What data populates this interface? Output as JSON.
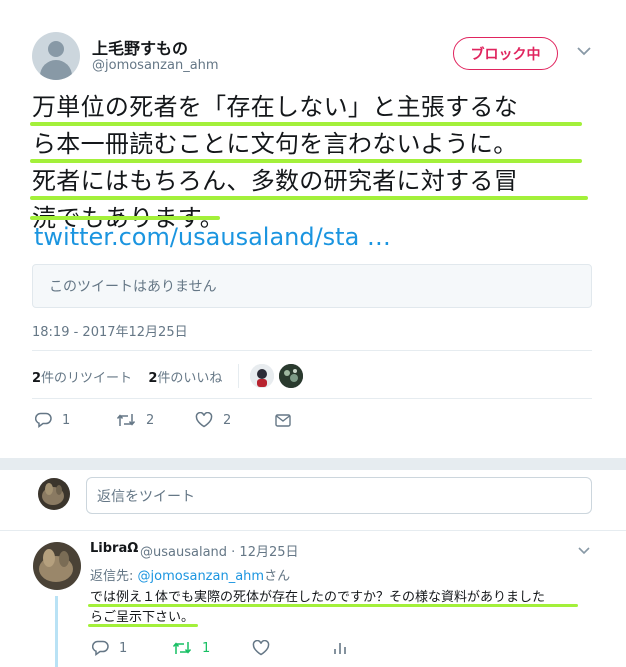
{
  "main_tweet": {
    "display_name": "上毛野すもの",
    "screen_name": "@jomosanzan_ahm",
    "block_button_label": "ブロック中",
    "caret_icon": "chevron-down-icon",
    "text_lines": [
      "万単位の死者を「存在しない」と主張するな",
      "ら本一冊読むことに文句を言わないように。",
      "死者にはもちろん、多数の研究者に対する冒",
      "涜でもあります。"
    ],
    "link_text": "twitter.com/usausaland/sta …",
    "quoted_tweet_unavailable": "このツイートはありません",
    "timestamp": "18:19 - 2017年12月25日",
    "retweets_count": "2",
    "retweets_label": "件のリツイート",
    "likes_count": "2",
    "likes_label": "件のいいね",
    "actions": {
      "reply_count": "1",
      "retweet_count": "2",
      "like_count": "2"
    }
  },
  "reply_box": {
    "placeholder": "返信をツイート"
  },
  "reply_tweet": {
    "display_name": "LibraΩ",
    "handle_and_date": "@usausaland · 12月25日",
    "replying_to_prefix": "返信先: ",
    "replying_to_mention": "@jomosanzan_ahm",
    "replying_to_suffix": "さん",
    "text_lines": [
      "では例え１体でも実際の死体が存在したのですか？その様な資料がありました",
      "らご呈示下さい。"
    ],
    "actions": {
      "reply_count": "1",
      "retweet_count": "1"
    }
  },
  "colors": {
    "accent_blue": "#1b95e0",
    "block_red": "#e0245e",
    "highlight_green": "#a3f03a",
    "retweet_green": "#17bf63",
    "muted_gray": "#657786"
  }
}
